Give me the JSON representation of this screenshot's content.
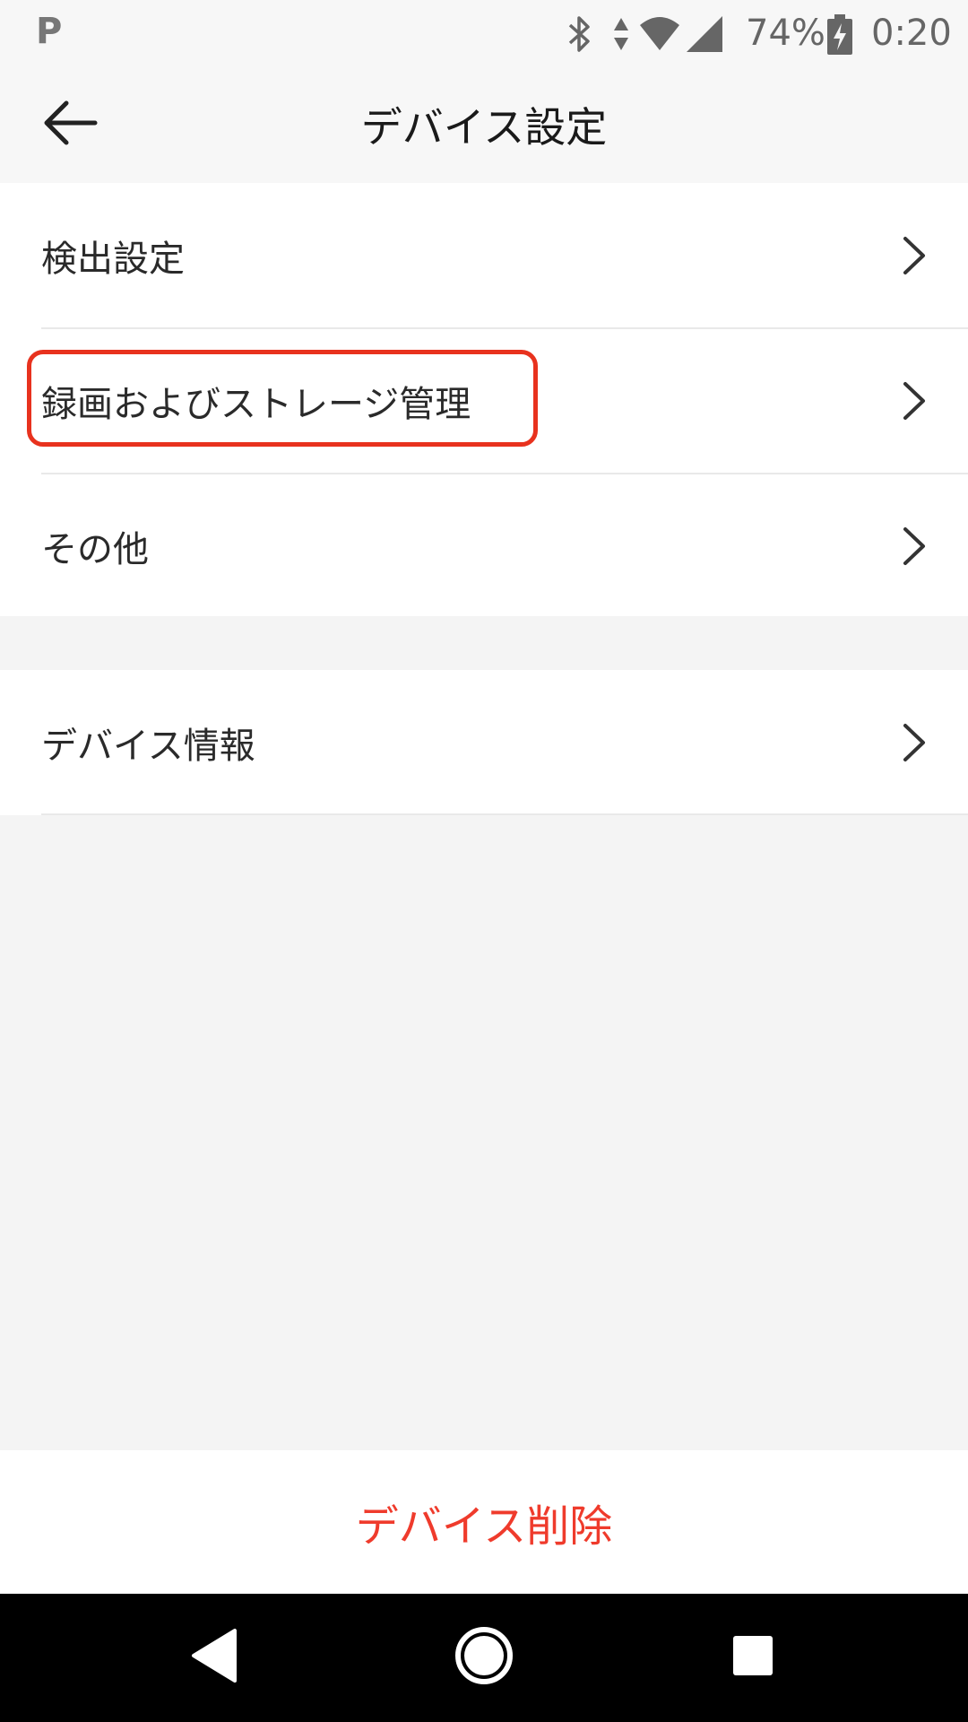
{
  "status_bar": {
    "notification_letter": "P",
    "battery_percent": "74%",
    "time": "0:20",
    "icons": [
      "bluetooth-icon",
      "data-arrows-icon",
      "wifi-icon",
      "signal-icon",
      "battery-charging-icon"
    ]
  },
  "header": {
    "title": "デバイス設定",
    "back_icon": "arrow-left-icon"
  },
  "settings_group_1": [
    {
      "label": "検出設定"
    },
    {
      "label": "録画およびストレージ管理"
    },
    {
      "label": "その他"
    }
  ],
  "settings_group_2": [
    {
      "label": "デバイス情報"
    }
  ],
  "delete_button": {
    "label": "デバイス削除"
  },
  "colors": {
    "accent_red": "#ef3b2c",
    "highlight_border": "#e8321e",
    "background": "#f4f4f4"
  },
  "nav_bar": {
    "icons": [
      "nav-back-icon",
      "nav-home-icon",
      "nav-recents-icon"
    ]
  }
}
